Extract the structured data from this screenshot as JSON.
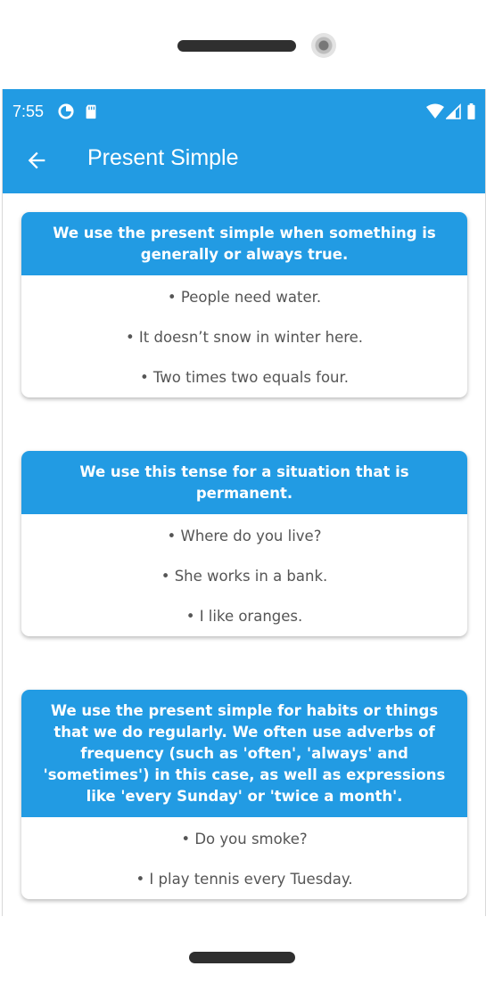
{
  "status_bar": {
    "time": "7:55"
  },
  "appbar": {
    "title": "Present Simple"
  },
  "cards": [
    {
      "heading": "We use the present simple when something is generally or always true.",
      "examples": [
        "• People need water.",
        "• It doesn’t snow in winter here.",
        "• Two times two equals four."
      ]
    },
    {
      "heading": "We use this tense for a situation that is permanent.",
      "examples": [
        "• Where do you live?",
        "• She works in a bank.",
        "• I like oranges."
      ]
    },
    {
      "heading": "We use the present simple for habits or things that we do regularly. We often use adverbs of frequency (such as 'often', 'always' and 'sometimes') in this case, as well as expressions like 'every Sunday' or 'twice a month'.",
      "examples": [
        "• Do you smoke?",
        "• I play tennis every Tuesday."
      ]
    }
  ],
  "colors": {
    "accent": "#229be3",
    "text_muted": "#555555"
  },
  "icons": [
    "back-arrow-icon",
    "data-saver-icon",
    "sd-card-icon",
    "wifi-icon",
    "signal-icon",
    "battery-icon"
  ]
}
